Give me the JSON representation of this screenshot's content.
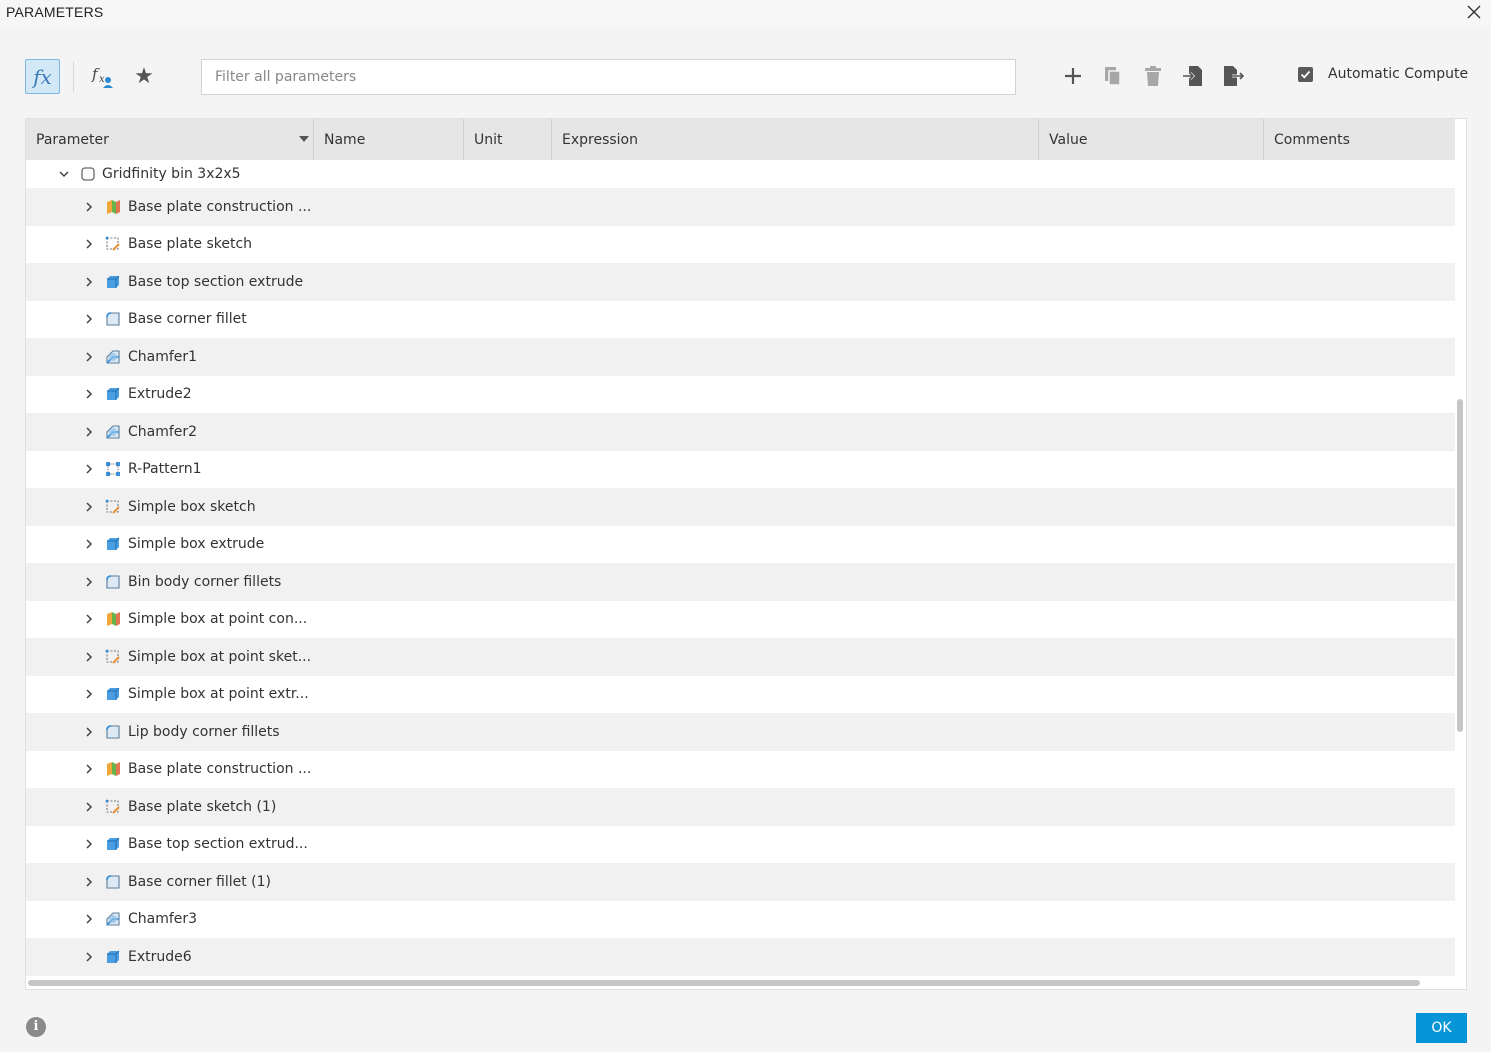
{
  "window": {
    "title": "PARAMETERS"
  },
  "toolbar": {
    "fx_label": "fx",
    "search_placeholder": "Filter all parameters",
    "search_value": "",
    "automatic_compute_label": "Automatic Compute",
    "automatic_compute_checked": true
  },
  "table": {
    "columns": [
      "Parameter",
      "Name",
      "Unit",
      "Expression",
      "Value",
      "Comments"
    ],
    "root": {
      "label": "Gridfinity bin 3x2x5",
      "expanded": true
    },
    "rows": [
      {
        "label": "Base plate construction ...",
        "icon": "construction-plane-icon"
      },
      {
        "label": "Base plate sketch",
        "icon": "sketch-icon"
      },
      {
        "label": "Base top section extrude",
        "icon": "extrude-icon"
      },
      {
        "label": "Base corner fillet",
        "icon": "fillet-icon"
      },
      {
        "label": "Chamfer1",
        "icon": "chamfer-icon"
      },
      {
        "label": "Extrude2",
        "icon": "extrude-icon"
      },
      {
        "label": "Chamfer2",
        "icon": "chamfer-icon"
      },
      {
        "label": "R-Pattern1",
        "icon": "rectangular-pattern-icon"
      },
      {
        "label": "Simple box sketch",
        "icon": "sketch-icon"
      },
      {
        "label": "Simple box extrude",
        "icon": "extrude-icon"
      },
      {
        "label": "Bin body corner fillets",
        "icon": "fillet-icon"
      },
      {
        "label": "Simple box at point con...",
        "icon": "construction-plane-icon"
      },
      {
        "label": "Simple box at point sket...",
        "icon": "sketch-icon"
      },
      {
        "label": "Simple box at point extr...",
        "icon": "extrude-icon"
      },
      {
        "label": "Lip body corner fillets",
        "icon": "fillet-icon"
      },
      {
        "label": "Base plate construction ...",
        "icon": "construction-plane-icon"
      },
      {
        "label": "Base plate sketch (1)",
        "icon": "sketch-icon"
      },
      {
        "label": "Base top section extrud...",
        "icon": "extrude-icon"
      },
      {
        "label": "Base corner fillet (1)",
        "icon": "fillet-icon"
      },
      {
        "label": "Chamfer3",
        "icon": "chamfer-icon"
      },
      {
        "label": "Extrude6",
        "icon": "extrude-icon"
      }
    ]
  },
  "footer": {
    "info_glyph": "i",
    "ok_label": "OK"
  },
  "colors": {
    "accent": "#0696d7",
    "fx_active_bg": "#d3e8f7",
    "row_alt": "#f1f1f1",
    "header_bg": "#e6e6e6"
  }
}
